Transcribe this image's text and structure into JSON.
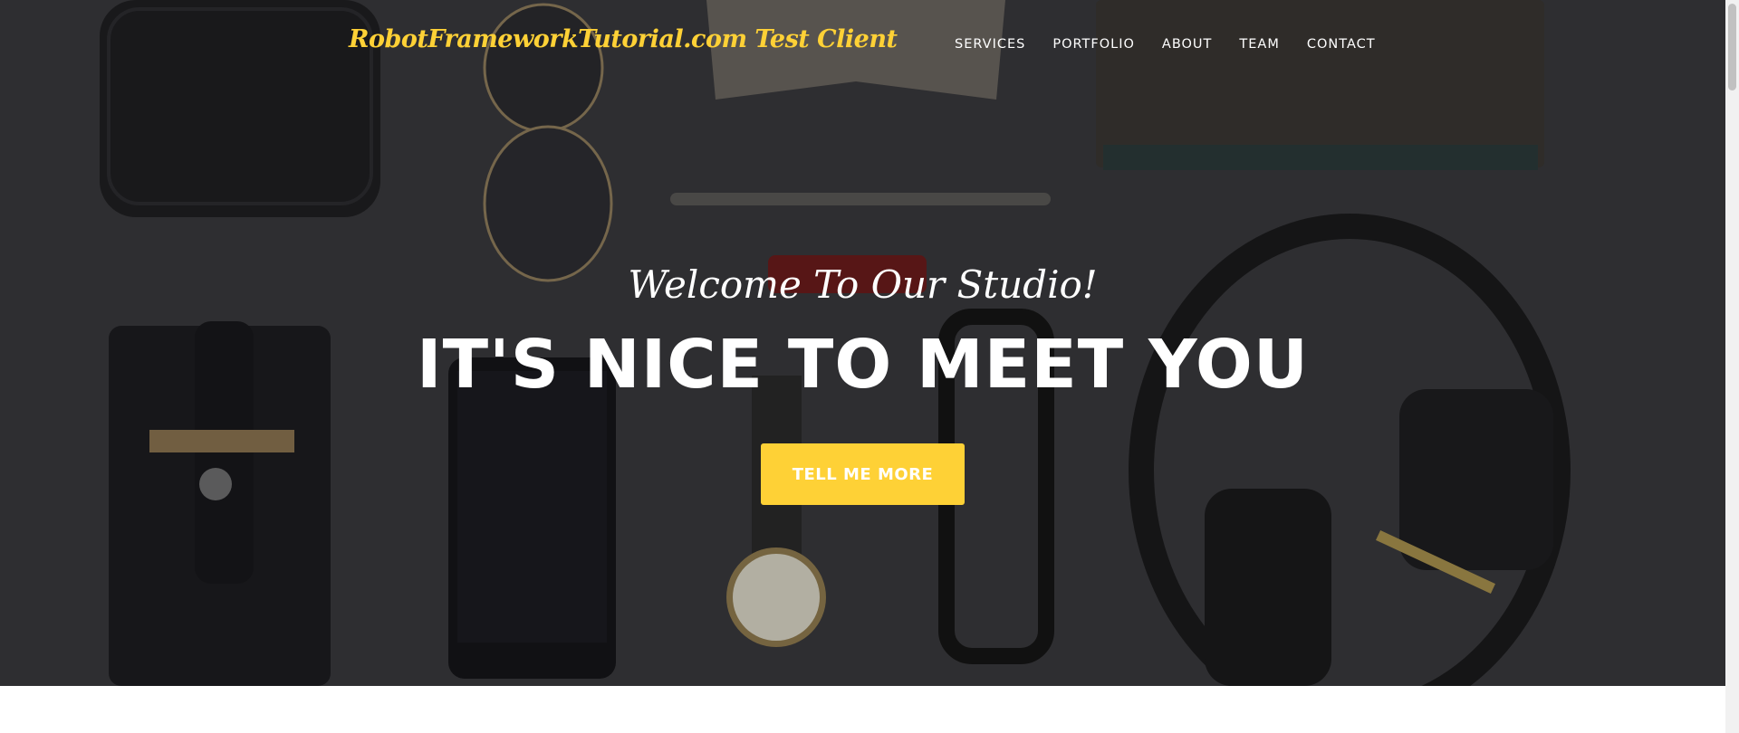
{
  "navbar": {
    "brand": "RobotFrameworkTutorial.com Test Client",
    "links": [
      {
        "label": "SERVICES"
      },
      {
        "label": "PORTFOLIO"
      },
      {
        "label": "ABOUT"
      },
      {
        "label": "TEAM"
      },
      {
        "label": "CONTACT"
      }
    ]
  },
  "hero": {
    "lead_in": "Welcome To Our Studio!",
    "heading": "IT'S NICE TO MEET YOU",
    "cta_label": "TELL ME MORE"
  },
  "colors": {
    "accent": "#fed136",
    "hero_background": "#3f3f41",
    "text_light": "#ffffff"
  }
}
